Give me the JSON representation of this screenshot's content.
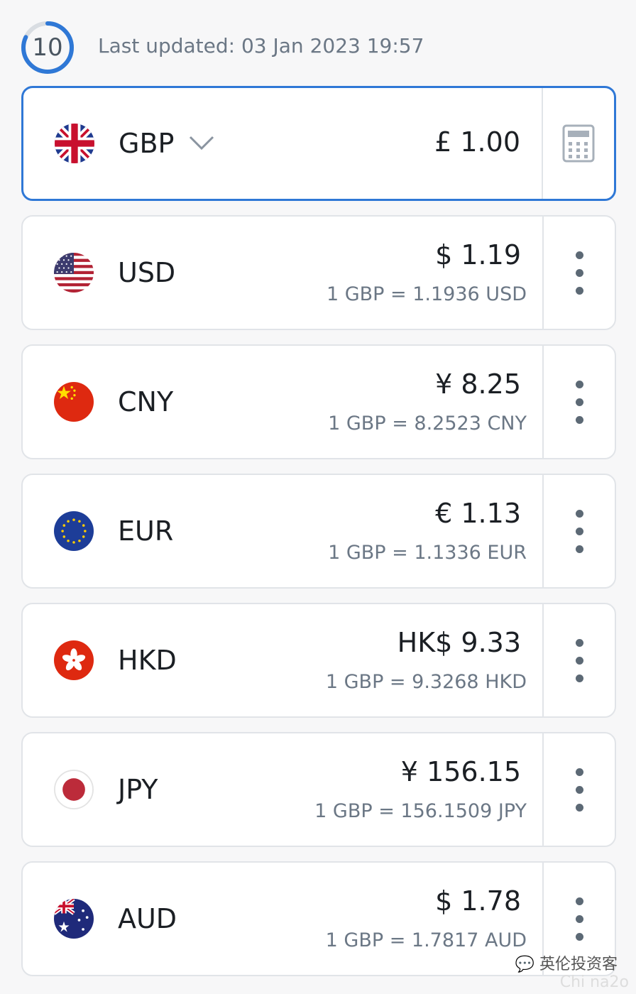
{
  "header": {
    "timer_value": "10",
    "timer_progress": 0.82,
    "last_updated": "Last updated: 03 Jan 2023 19:57"
  },
  "base": {
    "code": "GBP",
    "amount": "£ 1.00",
    "flag_icon": "uk-flag-icon",
    "calc_icon": "calculator-icon"
  },
  "rows": [
    {
      "code": "USD",
      "amount": "$ 1.19",
      "rate": "1 GBP = 1.1936 USD",
      "flag_icon": "us-flag-icon"
    },
    {
      "code": "CNY",
      "amount": "¥ 8.25",
      "rate": "1 GBP = 8.2523 CNY",
      "flag_icon": "china-flag-icon"
    },
    {
      "code": "EUR",
      "amount": "€ 1.13",
      "rate": "1 GBP = 1.1336 EUR",
      "flag_icon": "eu-flag-icon"
    },
    {
      "code": "HKD",
      "amount": "HK$ 9.33",
      "rate": "1 GBP = 9.3268 HKD",
      "flag_icon": "hong-kong-flag-icon"
    },
    {
      "code": "JPY",
      "amount": "¥ 156.15",
      "rate": "1 GBP = 156.1509 JPY",
      "flag_icon": "japan-flag-icon"
    },
    {
      "code": "AUD",
      "amount": "$ 1.78",
      "rate": "1 GBP = 1.7817 AUD",
      "flag_icon": "australia-flag-icon"
    }
  ],
  "watermark": {
    "text": "英伦投资客",
    "sub": "Chi na2o"
  },
  "colors": {
    "accent": "#2f78d6",
    "text": "#1b1f24",
    "muted": "#6b7785",
    "border": "#e1e4e8"
  }
}
